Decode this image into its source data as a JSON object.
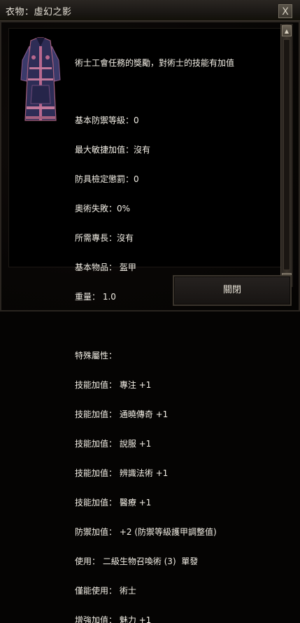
{
  "window": {
    "title": "衣物：虛幻之影",
    "close_glyph": "X"
  },
  "item": {
    "icon": "robe-icon",
    "description": "術士工會任務的獎勵，對術士的技能有加值",
    "basic_stats": [
      "基本防禦等級：0",
      "最大敏捷加值：沒有",
      "防具檢定懲罰：0",
      "奧術失敗：0%",
      "所需專長：沒有",
      "基本物品： 盔甲",
      "重量： 1.0"
    ],
    "properties_header": "特殊屬性：",
    "properties": [
      "技能加值： 專注 +1",
      "技能加值： 通曉傳奇 +1",
      "技能加值： 說服 +1",
      "技能加值： 辨識法術 +1",
      "技能加值： 醫療 +1",
      "防禦加值： +2 (防禦等級護甲調整值)",
      "使用： 二級生物召喚術 (3)  單發",
      "僅能使用： 術士",
      "增強加值： 魅力 +1"
    ]
  },
  "buttons": {
    "close_label": "關閉"
  },
  "scrollbar": {
    "up_glyph": "▲",
    "down_glyph": "▼"
  }
}
